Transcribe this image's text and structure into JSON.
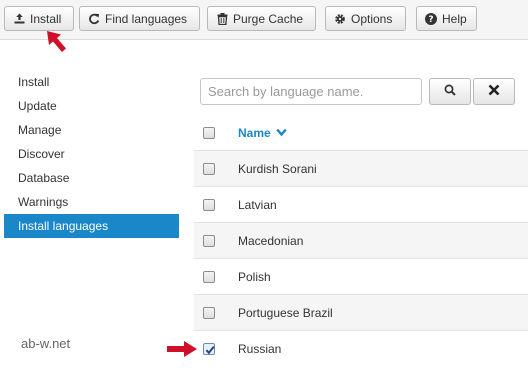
{
  "toolbar": {
    "install_label": "Install",
    "find_label": "Find languages",
    "purge_label": "Purge Cache",
    "options_label": "Options",
    "help_label": "Help"
  },
  "sidebar": {
    "items": [
      {
        "label": "Install",
        "active": false
      },
      {
        "label": "Update",
        "active": false
      },
      {
        "label": "Manage",
        "active": false
      },
      {
        "label": "Discover",
        "active": false
      },
      {
        "label": "Database",
        "active": false
      },
      {
        "label": "Warnings",
        "active": false
      },
      {
        "label": "Install languages",
        "active": true
      }
    ]
  },
  "search": {
    "placeholder": "Search by language name.",
    "value": ""
  },
  "table": {
    "header": "Name",
    "rows": [
      {
        "name": "Kurdish Sorani",
        "checked": false
      },
      {
        "name": "Latvian",
        "checked": false
      },
      {
        "name": "Macedonian",
        "checked": false
      },
      {
        "name": "Polish",
        "checked": false
      },
      {
        "name": "Portuguese Brazil",
        "checked": false
      },
      {
        "name": "Russian",
        "checked": true
      }
    ]
  },
  "watermark": "ab-w.net",
  "colors": {
    "accent": "#1a87c9",
    "arrow": "#d0102a"
  }
}
